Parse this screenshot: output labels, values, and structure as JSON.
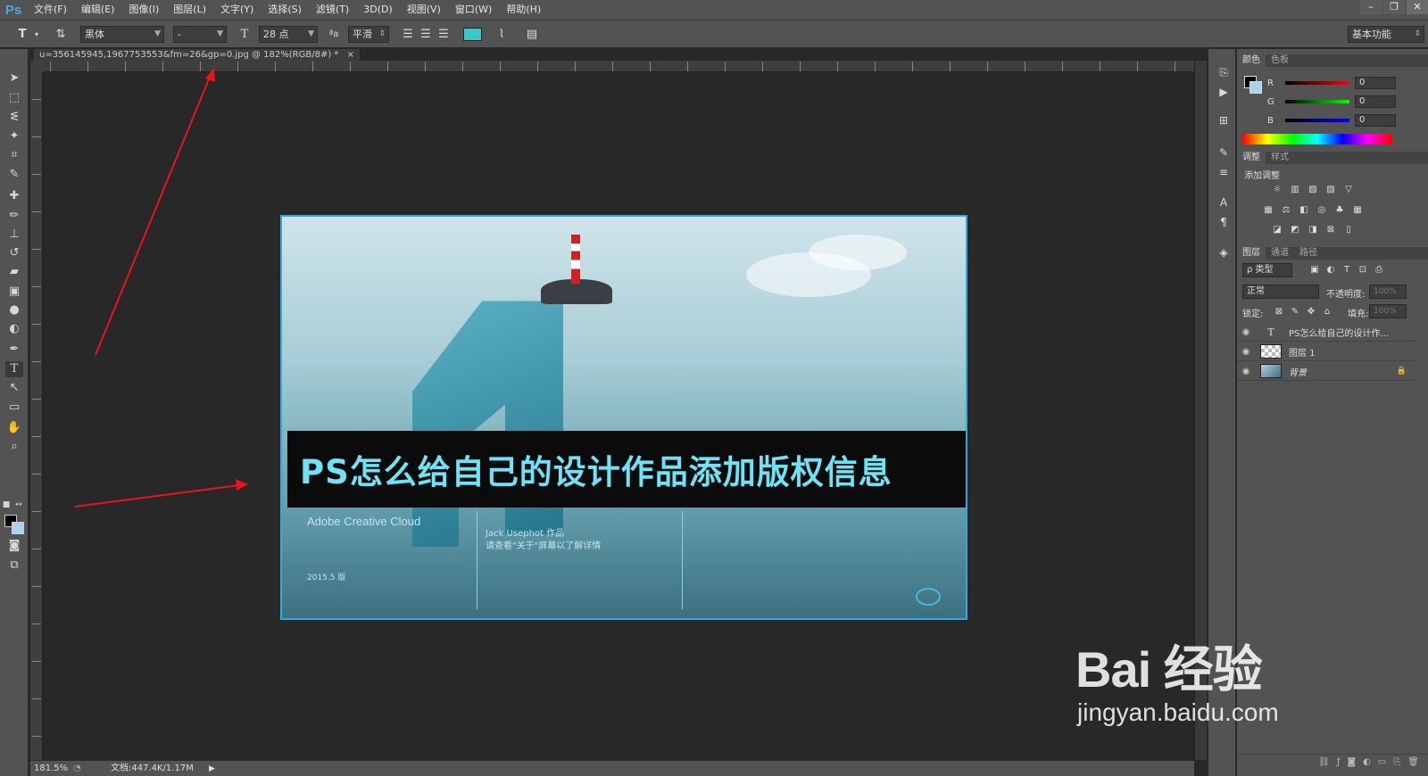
{
  "app": {
    "logo": "Ps"
  },
  "menu": [
    "文件(F)",
    "编辑(E)",
    "图像(I)",
    "图层(L)",
    "文字(Y)",
    "选择(S)",
    "滤镜(T)",
    "3D(D)",
    "视图(V)",
    "窗口(W)",
    "帮助(H)"
  ],
  "window_controls": {
    "minimize": "–",
    "restore": "❐",
    "close": "✕"
  },
  "options": {
    "font_family": "黑体",
    "font_style": "-",
    "font_size": "28 点",
    "aa_label": "ªa",
    "antialias": "平滑",
    "workspace": "基本功能",
    "text_color": "#3cc8c8"
  },
  "document": {
    "tab_title": "u=356145945,1967753553&fm=26&gp=0.jpg @ 182%(RGB/8#) *",
    "tab_close": "×"
  },
  "canvas_image": {
    "headline": "PS怎么给自己的设计作品添加版权信息",
    "brand": "Adobe Creative Cloud",
    "credit_line1": "Jack Usephot 作品",
    "credit_line2": "请查看\"关于\"屏幕以了解详情",
    "date": "2015.5 版"
  },
  "color_panel": {
    "tabs": [
      "颜色",
      "色板"
    ],
    "channels": [
      {
        "label": "R",
        "value": "0"
      },
      {
        "label": "G",
        "value": "0"
      },
      {
        "label": "B",
        "value": "0"
      }
    ]
  },
  "adjust_panel": {
    "tabs": [
      "调整",
      "样式"
    ],
    "title": "添加调整"
  },
  "layers_panel": {
    "tabs": [
      "图层",
      "通道",
      "路径"
    ],
    "filter_label": "ρ 类型",
    "blend_mode": "正常",
    "opacity_label": "不透明度:",
    "opacity_value": "100%",
    "lock_label": "锁定:",
    "fill_label": "填充:",
    "fill_value": "100%",
    "layers": [
      {
        "name": "PS怎么给自己的设计作...",
        "type_glyph": "T"
      },
      {
        "name": "图层 1"
      },
      {
        "name": "背景",
        "lock_glyph": "🔒"
      }
    ]
  },
  "status_bar": {
    "zoom": "181.5%",
    "doc_info": "文档:447.4K/1.17M",
    "play_glyph": "▶"
  },
  "watermark": {
    "big": "Bai 经验",
    "small": "jingyan.baidu.com"
  }
}
